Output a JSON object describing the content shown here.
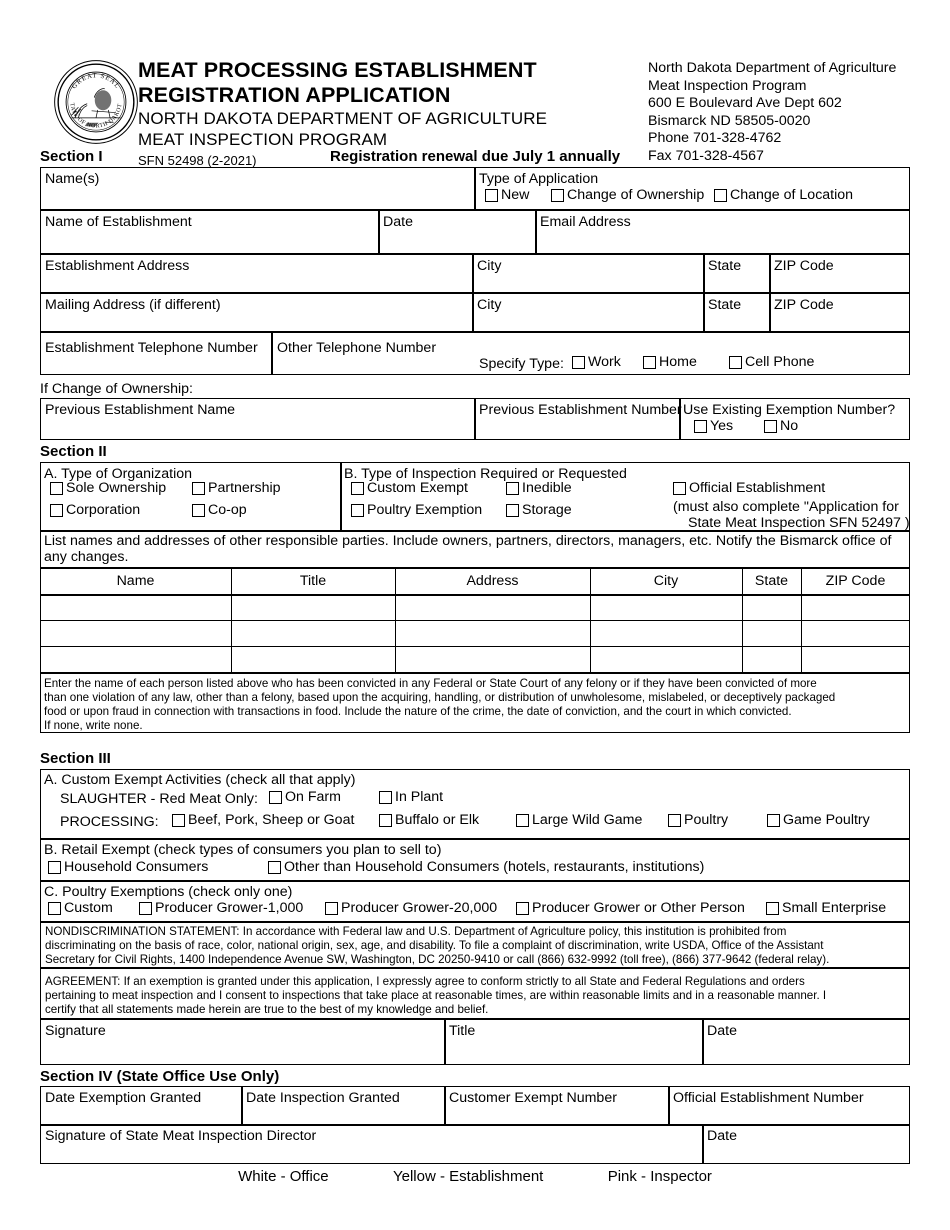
{
  "document": {
    "title_line1": "MEAT PROCESSING ESTABLISHMENT",
    "title_line2": "REGISTRATION APPLICATION",
    "subtitle_line1": "NORTH DAKOTA DEPARTMENT OF AGRICULTURE",
    "subtitle_line2": "MEAT INSPECTION PROGRAM",
    "form_number": "SFN 52498 (2-2021)",
    "seal_top_text": "GREAT SEAL",
    "seal_bottom_text": "STATE OF NORTH DAKOTA"
  },
  "agency_address": {
    "line1": "North Dakota Department of Agriculture",
    "line2": "Meat Inspection Program",
    "line3": "600 E Boulevard Ave  Dept 602",
    "line4": "Bismarck ND 58505-0020",
    "line5": "Phone  701-328-4762",
    "line6": "Fax  701-328-4567"
  },
  "section1": {
    "heading": "Section I",
    "renewal_notice": "Registration renewal due July 1 annually",
    "names_label": "Name(s)",
    "type_of_application_label": "Type of Application",
    "type_of_application_options": [
      "New",
      "Change of Ownership",
      "Change of Location"
    ],
    "establishment_name_label": "Name of Establishment",
    "date_label": "Date",
    "email_label": "Email Address",
    "establishment_address_label": "Establishment Address",
    "mailing_address_label": "Mailing Address (if different)",
    "city_label": "City",
    "state_label": "State",
    "zip_label": "ZIP Code",
    "establishment_phone_label": "Establishment Telephone Number",
    "other_phone_label": "Other Telephone Number",
    "specify_type_label": "Specify Type:",
    "phone_type_options": [
      "Work",
      "Home",
      "Cell Phone"
    ],
    "change_of_ownership_note": "If Change of Ownership:",
    "previous_establishment_name_label": "Previous Establishment Name",
    "previous_establishment_number_label": "Previous Establishment Number",
    "use_existing_exemption_label": "Use Existing Exemption Number?",
    "use_existing_exemption_options": [
      "Yes",
      "No"
    ]
  },
  "section2": {
    "heading": "Section II",
    "org_heading": "A.  Type of Organization",
    "org_options": [
      "Sole Ownership",
      "Partnership",
      "Corporation",
      "Co-op"
    ],
    "inspection_heading": "B.  Type of Inspection Required or Requested",
    "inspection_options": [
      "Custom Exempt",
      "Inedible",
      "Poultry Exemption",
      "Storage",
      "Official Establishment"
    ],
    "official_note_line1": "(must also complete \"Application for",
    "official_note_line2": "State Meat Inspection SFN 52497 )",
    "list_instructions_line1": "List names and addresses of other responsible parties.  Include owners, partners, directors, managers, etc.  Notify the Bismarck office of",
    "list_instructions_line2": "any changes.",
    "table_headers": [
      "Name",
      "Title",
      "Address",
      "City",
      "State",
      "ZIP Code"
    ],
    "table_rows": [
      [
        "",
        "",
        "",
        "",
        "",
        ""
      ],
      [
        "",
        "",
        "",
        "",
        "",
        ""
      ],
      [
        "",
        "",
        "",
        "",
        "",
        ""
      ]
    ],
    "conviction_text_line1": "Enter the name of each person listed above who has been convicted in any Federal or State Court of any felony or if they have been convicted  of more",
    "conviction_text_line2": "than one violation of any law, other than a felony, based upon the acquiring, handling, or distribution of unwholesome, mislabeled, or deceptively packaged",
    "conviction_text_line3": "food or upon fraud in connection with transactions in food.  Include the nature of the crime, the date of conviction, and the court in which convicted.",
    "conviction_text_line4": "If none, write none."
  },
  "section3": {
    "heading": "Section III",
    "a_heading": "A. Custom Exempt Activities (check all that apply)",
    "slaughter_label": "SLAUGHTER - Red Meat Only:",
    "slaughter_options": [
      "On Farm",
      "In Plant"
    ],
    "processing_label": "PROCESSING:",
    "processing_options": [
      "Beef, Pork, Sheep or Goat",
      "Buffalo or Elk",
      "Large Wild Game",
      "Poultry",
      "Game Poultry"
    ],
    "b_heading": "B. Retail Exempt (check types of consumers you plan to sell to)",
    "b_options": [
      "Household Consumers",
      "Other than Household Consumers (hotels, restaurants, institutions)"
    ],
    "c_heading": "C. Poultry Exemptions (check only one)",
    "c_options": [
      "Custom",
      "Producer Grower-1,000",
      "Producer Grower-20,000",
      "Producer Grower or Other Person",
      "Small Enterprise"
    ],
    "nondiscrimination_line1": "NONDISCRIMINATION STATEMENT: In accordance with Federal law and U.S. Department of Agriculture policy, this institution is prohibited from",
    "nondiscrimination_line2": "discriminating on the basis of race, color, national origin, sex, age, and disability. To file a complaint of discrimination, write USDA, Office of the Assistant",
    "nondiscrimination_line3": "Secretary for Civil Rights, 1400 Independence Avenue SW, Washington, DC 20250-9410 or call (866) 632-9992 (toll free), (866) 377-9642 (federal relay).",
    "agreement_line1": "AGREEMENT: If an exemption is granted under this application, I expressly agree to conform strictly to all State and Federal Regulations and orders",
    "agreement_line2": "pertaining to meat inspection and I consent to inspections that take place at reasonable times, are within reasonable limits and in a reasonable manner. I",
    "agreement_line3": "certify that all statements made herein are true to the best of my knowledge and belief.",
    "signature_label": "Signature",
    "title_label": "Title",
    "date_label": "Date"
  },
  "section4": {
    "heading": "Section IV (State Office Use Only)",
    "date_exemption_granted_label": "Date Exemption Granted",
    "date_inspection_granted_label": "Date Inspection Granted",
    "customer_exempt_number_label": "Customer Exempt Number",
    "official_establishment_number_label": "Official Establishment Number",
    "director_signature_label": "Signature of State Meat Inspection Director",
    "date_label": "Date"
  },
  "footer": {
    "copy1": "White - Office",
    "copy2": "Yellow - Establishment",
    "copy3": "Pink - Inspector"
  }
}
